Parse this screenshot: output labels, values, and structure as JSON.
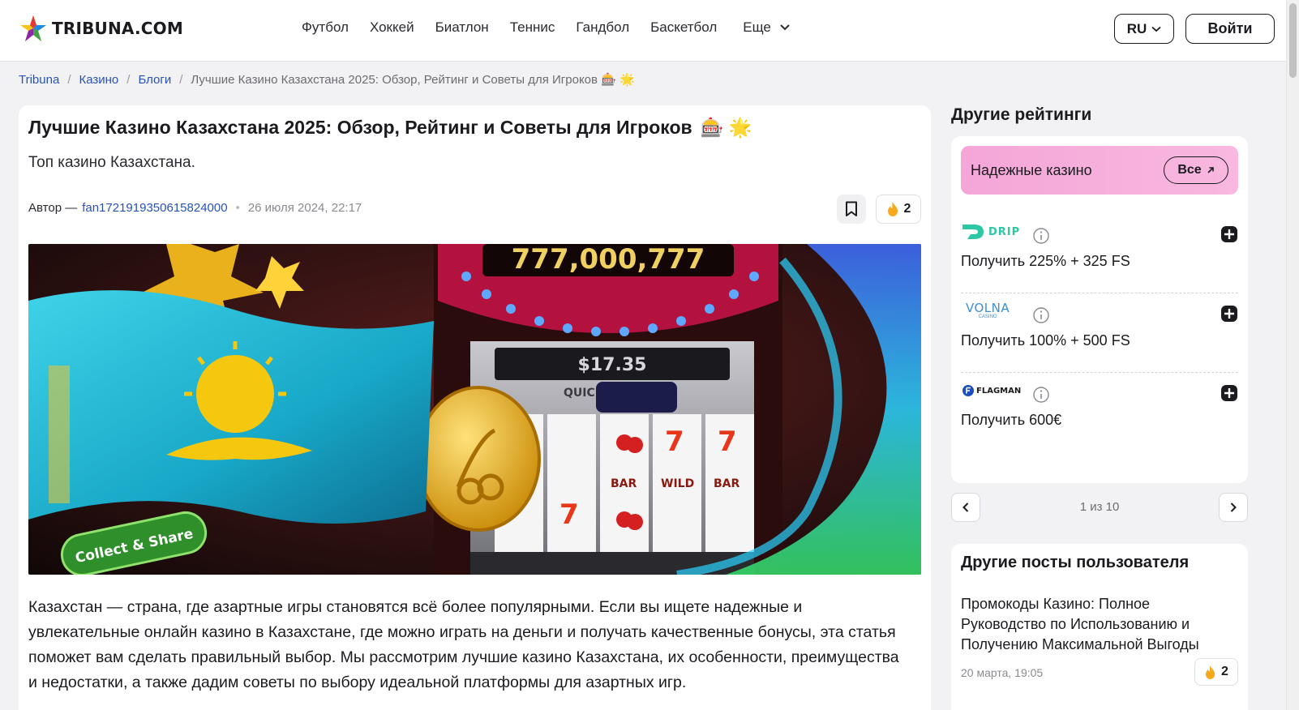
{
  "header": {
    "logo_text": "TRIBUNA.COM",
    "nav": [
      "Футбол",
      "Хоккей",
      "Биатлон",
      "Теннис",
      "Гандбол",
      "Баскетбол"
    ],
    "more_label": "Еще",
    "lang_label": "RU",
    "login_label": "Войти"
  },
  "breadcrumb": {
    "items": [
      "Tribuna",
      "Казино",
      "Блоги"
    ],
    "current": "Лучшие Казино Казахстана 2025: Обзор, Рейтинг и Советы для Игроков 🎰 🌟"
  },
  "article": {
    "title": "Лучшие Казино Казахстана 2025: Обзор, Рейтинг и Советы для Игроков",
    "title_emoji": "🎰 🌟",
    "subtitle": "Топ казино Казахстана.",
    "author_prefix": "Автор —",
    "author": "fan1721919350615824000",
    "date": "26 июля 2024, 22:17",
    "reactions": "2",
    "image_text": {
      "collect_share": "Collect & Share",
      "quick_hit": "QUICK HIT"
    },
    "body": "Казахстан — страна, где азартные игры становятся всё более популярными. Если вы ищете надежные и увлекательные онлайн казино в Казахстане, где можно играть на деньги и получать качественные бонусы, эта статья поможет вам сделать правильный выбор. Мы рассмотрим лучшие казино Казахстана, их особенности, преимущества и недостатки, а также дадим советы по выбору идеальной платформы для азартных игр."
  },
  "sidebar": {
    "heading": "Другие рейтинги",
    "banner_label": "Надежные казино",
    "all_label": "Все",
    "casinos": [
      {
        "name": "DRIP",
        "offer": "Получить 225% + 325 FS",
        "color": "#2dc7a4"
      },
      {
        "name": "VOLNA",
        "sub": "CASINO",
        "offer": "Получить 100% + 500 FS",
        "color": "#3a8fd6"
      },
      {
        "name": "FLAGMAN",
        "offer": "Получить 600€",
        "color": "#1b4fbf"
      }
    ],
    "pager_label": "1 из 10",
    "posts_heading": "Другие посты пользователя",
    "post_title": "Промокоды Казино: Полное Руководство по Использованию и Получению Максимальной Выгоды",
    "post_date": "20 марта, 19:05",
    "post_reactions": "2"
  },
  "colors": {
    "link": "#2852b8",
    "banner_pink": "#f4a6d8",
    "flame": "#f7a91c"
  }
}
